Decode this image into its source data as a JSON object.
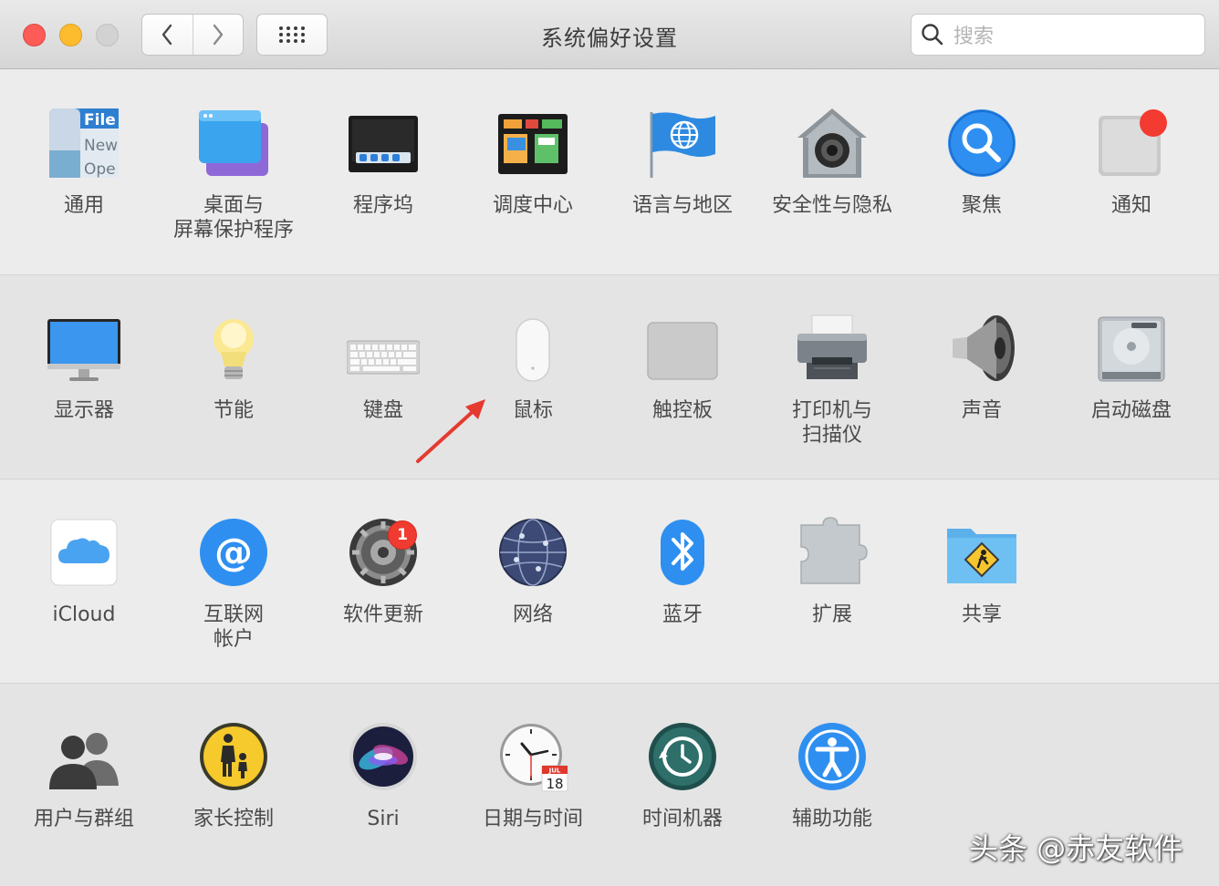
{
  "window": {
    "title": "系统偏好设置",
    "search_placeholder": "搜索",
    "traffic_lights": [
      "close",
      "minimize",
      "zoom"
    ]
  },
  "colors": {
    "close": "#fc5b57",
    "minimize": "#fdbc2e",
    "annotation_arrow": "#e53a30",
    "badge": "#f03b30"
  },
  "sections": [
    {
      "panes": [
        {
          "id": "general",
          "label": "通用",
          "icon": "general-icon"
        },
        {
          "id": "desktop",
          "label": "桌面与\n屏幕保护程序",
          "icon": "desktop-screensaver-icon"
        },
        {
          "id": "dock",
          "label": "程序坞",
          "icon": "dock-icon"
        },
        {
          "id": "mission",
          "label": "调度中心",
          "icon": "mission-control-icon"
        },
        {
          "id": "language",
          "label": "语言与地区",
          "icon": "language-region-icon"
        },
        {
          "id": "security",
          "label": "安全性与隐私",
          "icon": "security-privacy-icon"
        },
        {
          "id": "spotlight",
          "label": "聚焦",
          "icon": "spotlight-icon"
        },
        {
          "id": "notifications",
          "label": "通知",
          "icon": "notifications-icon"
        }
      ]
    },
    {
      "panes": [
        {
          "id": "displays",
          "label": "显示器",
          "icon": "display-icon"
        },
        {
          "id": "energy",
          "label": "节能",
          "icon": "energy-saver-icon"
        },
        {
          "id": "keyboard",
          "label": "键盘",
          "icon": "keyboard-icon"
        },
        {
          "id": "mouse",
          "label": "鼠标",
          "icon": "mouse-icon"
        },
        {
          "id": "trackpad",
          "label": "触控板",
          "icon": "trackpad-icon"
        },
        {
          "id": "printers",
          "label": "打印机与\n扫描仪",
          "icon": "printer-scanner-icon"
        },
        {
          "id": "sound",
          "label": "声音",
          "icon": "sound-icon"
        },
        {
          "id": "startup",
          "label": "启动磁盘",
          "icon": "startup-disk-icon"
        }
      ]
    },
    {
      "panes": [
        {
          "id": "icloud",
          "label": "iCloud",
          "icon": "icloud-icon"
        },
        {
          "id": "internet",
          "label": "互联网\n帐户",
          "icon": "internet-accounts-icon"
        },
        {
          "id": "update",
          "label": "软件更新",
          "icon": "software-update-icon",
          "badge": "1"
        },
        {
          "id": "network",
          "label": "网络",
          "icon": "network-icon"
        },
        {
          "id": "bluetooth",
          "label": "蓝牙",
          "icon": "bluetooth-icon"
        },
        {
          "id": "extensions",
          "label": "扩展",
          "icon": "extensions-icon"
        },
        {
          "id": "sharing",
          "label": "共享",
          "icon": "sharing-icon"
        }
      ]
    },
    {
      "panes": [
        {
          "id": "users",
          "label": "用户与群组",
          "icon": "users-groups-icon"
        },
        {
          "id": "parental",
          "label": "家长控制",
          "icon": "parental-controls-icon"
        },
        {
          "id": "siri",
          "label": "Siri",
          "icon": "siri-icon"
        },
        {
          "id": "datetime",
          "label": "日期与时间",
          "icon": "date-time-icon",
          "icon_text": [
            "JUL",
            "18"
          ]
        },
        {
          "id": "timemachine",
          "label": "时间机器",
          "icon": "time-machine-icon"
        },
        {
          "id": "accessibility",
          "label": "辅助功能",
          "icon": "accessibility-icon"
        }
      ]
    }
  ],
  "icon_text": {
    "general": [
      "File",
      "New",
      "Ope"
    ]
  },
  "watermark": "头条 @赤友软件"
}
